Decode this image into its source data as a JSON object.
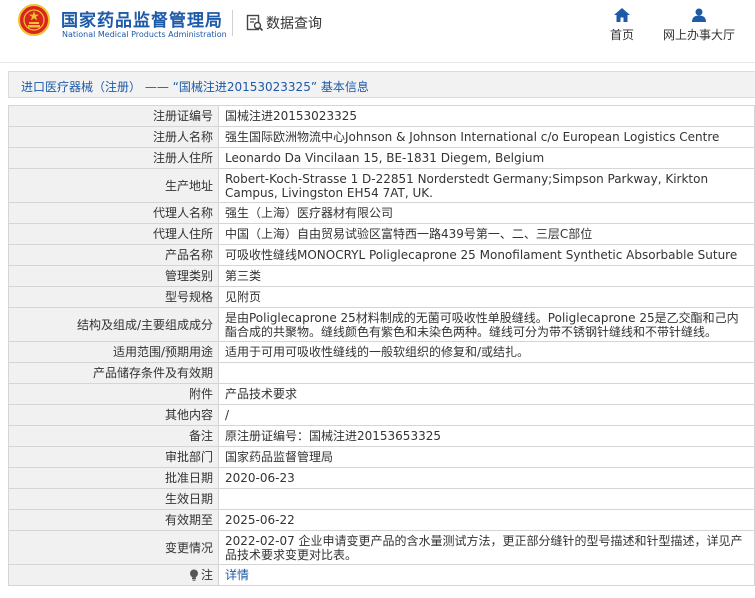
{
  "header": {
    "logo_cn": "国家药品监督管理局",
    "logo_en": "National Medical Products Administration",
    "query_label": "数据查询",
    "nav": [
      {
        "label": "首页",
        "icon": "home-icon"
      },
      {
        "label": "网上办事大厅",
        "icon": "user-icon"
      }
    ]
  },
  "breadcrumb": "进口医疗器械（注册） —— “国械注进20153023325” 基本信息",
  "fields": {
    "reg_no": {
      "label": "注册证编号",
      "value": "国械注进20153023325"
    },
    "registrant": {
      "label": "注册人名称",
      "value": "强生国际欧洲物流中心Johnson & Johnson International c/o European Logistics Centre"
    },
    "reg_address": {
      "label": "注册人住所",
      "value": "Leonardo Da Vincilaan 15, BE-1831 Diegem, Belgium"
    },
    "mfg_address": {
      "label": "生产地址",
      "value": "Robert-Koch-Strasse 1 D-22851 Norderstedt Germany;Simpson Parkway, Kirkton Campus, Livingston EH54 7AT, UK."
    },
    "agent": {
      "label": "代理人名称",
      "value": "强生（上海）医疗器材有限公司"
    },
    "agent_address": {
      "label": "代理人住所",
      "value": "中国（上海）自由贸易试验区富特西一路439号第一、二、三层C部位"
    },
    "product_name": {
      "label": "产品名称",
      "value": "可吸收性缝线MONOCRYL Poliglecaprone 25 Monofilament Synthetic Absorbable Suture"
    },
    "category": {
      "label": "管理类别",
      "value": "第三类"
    },
    "model": {
      "label": "型号规格",
      "value": "见附页"
    },
    "structure": {
      "label": "结构及组成/主要组成成分",
      "value": "是由Poliglecaprone 25材料制成的无菌可吸收性单股缝线。Poliglecaprone 25是乙交酯和己内酯合成的共聚物。缝线颜色有紫色和未染色两种。缝线可分为带不锈钢针缝线和不带针缝线。"
    },
    "scope": {
      "label": "适用范围/预期用途",
      "value": "适用于可用可吸收性缝线的一般软组织的修复和/或结扎。"
    },
    "storage": {
      "label": "产品储存条件及有效期",
      "value": ""
    },
    "attachment": {
      "label": "附件",
      "value": "产品技术要求"
    },
    "other": {
      "label": "其他内容",
      "value": "/"
    },
    "remark": {
      "label": "备注",
      "value": "原注册证编号：国械注进20153653325"
    },
    "dept": {
      "label": "审批部门",
      "value": "国家药品监督管理局"
    },
    "approval_date": {
      "label": "批准日期",
      "value": "2020-06-23"
    },
    "effective_date": {
      "label": "生效日期",
      "value": ""
    },
    "valid_until": {
      "label": "有效期至",
      "value": "2025-06-22"
    },
    "changes": {
      "label": "变更情况",
      "value": "2022-02-07 企业申请变更产品的含水量测试方法，更正部分缝针的型号描述和针型描述，详见产品技术要求变更对比表。"
    },
    "note": {
      "label": "注",
      "value": "详情"
    }
  },
  "colors": {
    "brand": "#1d5aa8",
    "label_bg": "#f1f1f1",
    "border": "#d5d5d5",
    "emblem_red": "#d8261c",
    "emblem_gold": "#f2c230"
  }
}
